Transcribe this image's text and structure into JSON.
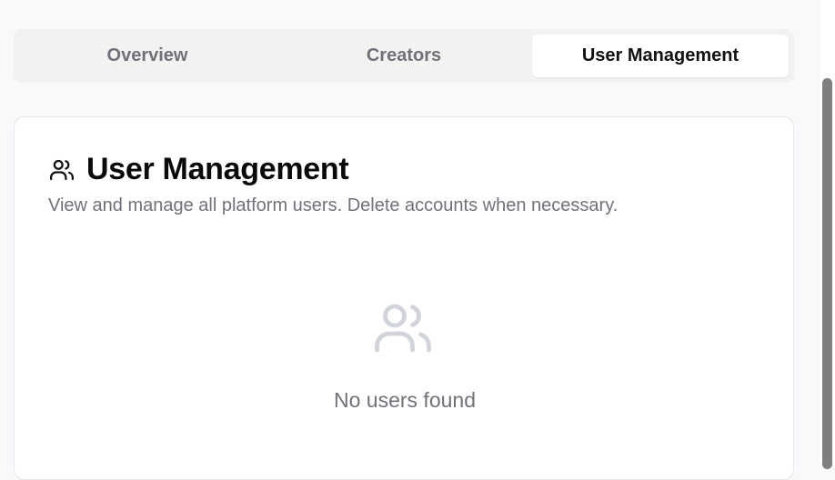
{
  "tabs": [
    {
      "label": "Overview",
      "active": false
    },
    {
      "label": "Creators",
      "active": false
    },
    {
      "label": "User Management",
      "active": true
    }
  ],
  "card": {
    "icon": "users-icon",
    "title": "User Management",
    "description": "View and manage all platform users. Delete accounts when necessary."
  },
  "empty_state": {
    "icon": "users-icon",
    "message": "No users found"
  },
  "colors": {
    "page_background": "#f8f9fa",
    "tab_bar_background": "#f2f2f0",
    "muted_text": "#71717a",
    "empty_icon": "#d1d5db"
  }
}
